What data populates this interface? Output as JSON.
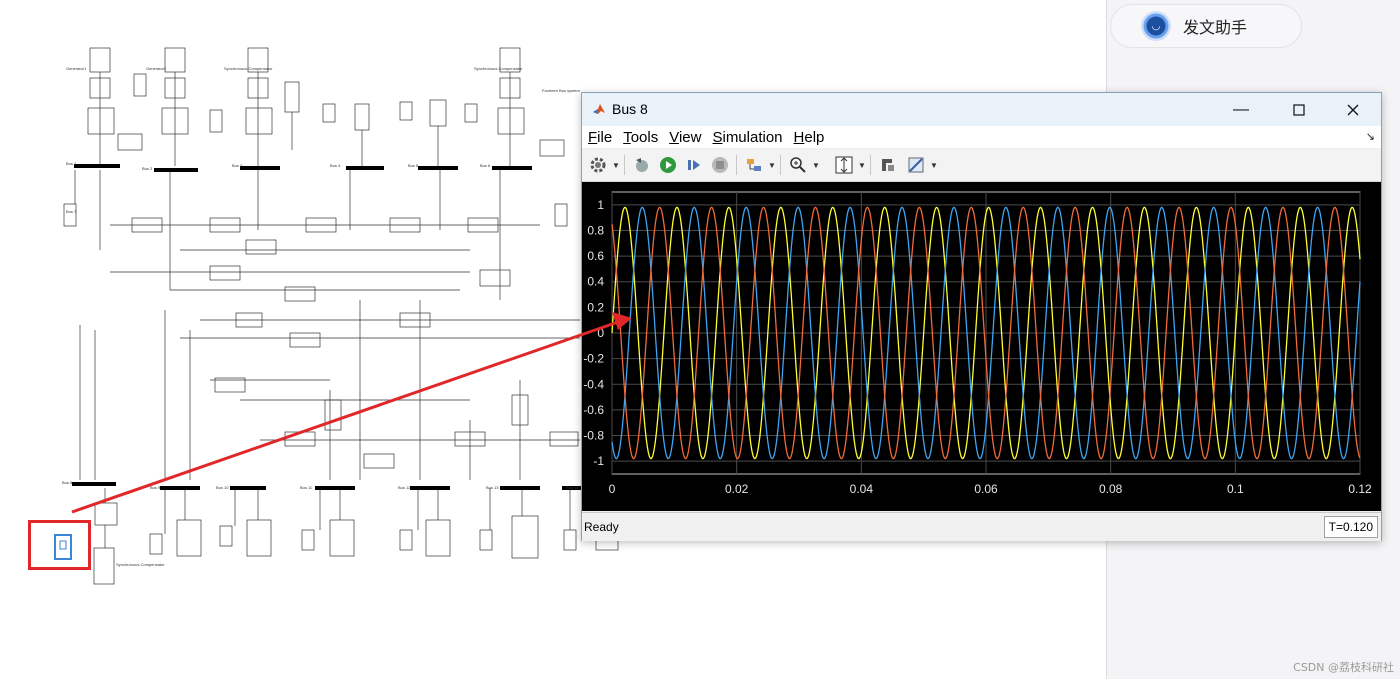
{
  "model": {
    "top_labels": [
      "Generator1",
      "Generator2",
      "Synchronous Compensator",
      "Synchronous Compensator",
      "Fourteen Bus system"
    ],
    "bus_labels": [
      "Bus 1",
      "Bus 2",
      "Bus 3",
      "Bus 4",
      "Bus 5",
      "Bus 6",
      "Bus 7",
      "Bus 8",
      "Bus 9",
      "Bus 10",
      "Bus 11",
      "Bus 12",
      "Bus 13",
      "Bus 14"
    ],
    "bottom_label": "Synchronous Compensator"
  },
  "sidebar": {
    "assistant_label": "发文助手"
  },
  "watermark": "CSDN @荔枝科研社",
  "scope_window": {
    "title": "Bus 8",
    "menu": [
      "File",
      "Tools",
      "View",
      "Simulation",
      "Help"
    ],
    "menu_mnemonics": [
      "F",
      "T",
      "V",
      "S",
      "H"
    ],
    "status": "Ready",
    "time": "T=0.120",
    "toolbar_icons": [
      "settings-icon",
      "step-back-icon",
      "run-icon",
      "step-forward-icon",
      "stop-icon",
      "highlight-icon",
      "zoom-in-icon",
      "fit-axes-icon",
      "style-icon",
      "measurement-icon"
    ]
  },
  "chart_data": {
    "type": "line",
    "title": "",
    "xlabel": "",
    "ylabel": "",
    "xlim": [
      0,
      0.12
    ],
    "ylim": [
      -1.1,
      1.1
    ],
    "xticks": [
      "0",
      "0.02",
      "0.04",
      "0.06",
      "0.08",
      "0.1",
      "0.12"
    ],
    "yticks": [
      "1",
      "0.8",
      "0.6",
      "0.4",
      "0.2",
      "0",
      "-0.2",
      "-0.4",
      "-0.6",
      "-0.8",
      "-1"
    ],
    "grid": true,
    "frequency_hz": 120,
    "amplitude": 0.98,
    "series": [
      {
        "color": "#ffff33",
        "phase_deg": 0
      },
      {
        "color": "#3fa5f2",
        "phase_deg": -120
      },
      {
        "color": "#f06a3a",
        "phase_deg": 120
      }
    ]
  },
  "colors": {
    "highlight": "#e0282a",
    "arrow": "#e0282a",
    "plot_bg": "#000000",
    "grid": "#4a4a4a"
  }
}
